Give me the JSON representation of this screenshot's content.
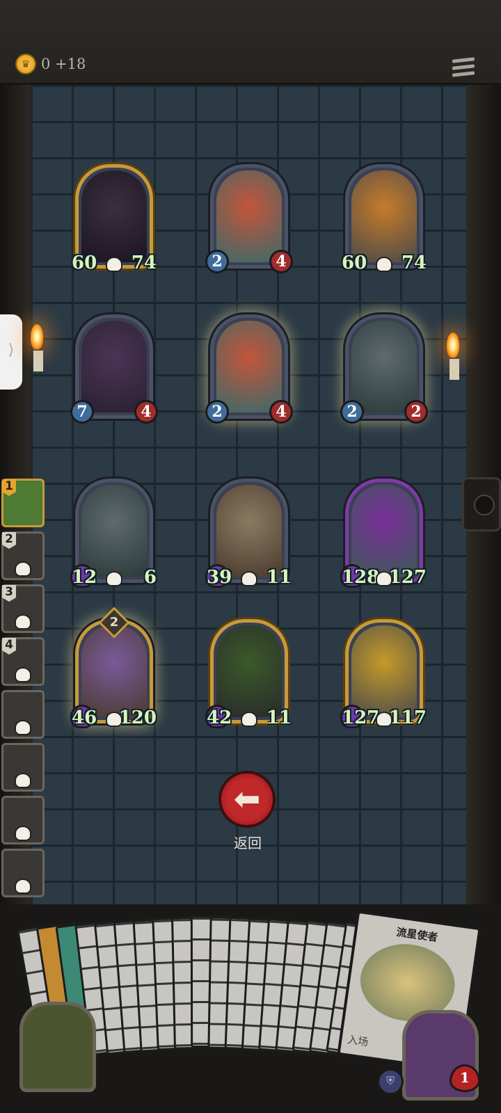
{
  "header": {
    "coin_icon": "crown-coin-icon",
    "gold_text": "0 +18",
    "menu_icon": "hamburger-menu-icon"
  },
  "board": {
    "rows": [
      [
        {
          "atk": "60",
          "hp": "74",
          "style": "gold",
          "stat_style": "plain",
          "colors": [
            "#3a2f40",
            "#1b1420"
          ]
        },
        {
          "atk": "2",
          "hp": "4",
          "style": "silver",
          "stat_style": "badge",
          "colors": [
            "#c4553a",
            "#3a6a6a"
          ]
        },
        {
          "atk": "60",
          "hp": "74",
          "style": "silver",
          "stat_style": "plain",
          "colors": [
            "#c77b2a",
            "#4a4a4a"
          ]
        }
      ],
      [
        {
          "atk": "7",
          "hp": "4",
          "style": "silver",
          "stat_style": "badge",
          "colors": [
            "#4a3456",
            "#2a2030"
          ]
        },
        {
          "atk": "2",
          "hp": "4",
          "style": "silver-glow",
          "stat_style": "badge",
          "colors": [
            "#c4553a",
            "#3a6a6a"
          ]
        },
        {
          "atk": "2",
          "hp": "2",
          "style": "silver-glow",
          "stat_style": "badge",
          "colors": [
            "#5f6a6c",
            "#2a3a3a"
          ]
        }
      ],
      [
        {
          "atk": "12",
          "hp": "6",
          "style": "silver",
          "stat_style": "purple",
          "colors": [
            "#5f6a6c",
            "#2a3a3a"
          ]
        },
        {
          "atk": "39",
          "hp": "11",
          "style": "silver",
          "stat_style": "purple",
          "colors": [
            "#8b7a62",
            "#4a3a2c"
          ]
        },
        {
          "atk": "128",
          "hp": "127",
          "style": "purple",
          "stat_style": "purple",
          "colors": [
            "#7a2f9a",
            "#3a5a56"
          ]
        }
      ],
      [
        {
          "atk": "46",
          "hp": "120",
          "style": "gold-glow",
          "stat_style": "purple",
          "tier": "2",
          "colors": [
            "#7a5a9a",
            "#4a3a30"
          ]
        },
        {
          "atk": "42",
          "hp": "11",
          "style": "gold",
          "stat_style": "purple",
          "colors": [
            "#3a5a2a",
            "#2a2a2a"
          ]
        },
        {
          "atk": "127",
          "hp": "117",
          "style": "gold",
          "stat_style": "purple",
          "colors": [
            "#c49a2a",
            "#4a4a4a"
          ]
        }
      ]
    ]
  },
  "back_button": {
    "icon": "left-arrow-icon",
    "label": "返回"
  },
  "hero_list": [
    {
      "num": "1",
      "active": true
    },
    {
      "num": "2"
    },
    {
      "num": "3"
    },
    {
      "num": "4"
    },
    {
      "num": ""
    },
    {
      "num": ""
    },
    {
      "num": ""
    },
    {
      "num": ""
    }
  ],
  "hand": {
    "featured_card_name": "流星使者",
    "featured_card_keyword": "入场",
    "card_count": 18
  },
  "player": {
    "life": "1",
    "shield_icon": "shield-icon"
  }
}
